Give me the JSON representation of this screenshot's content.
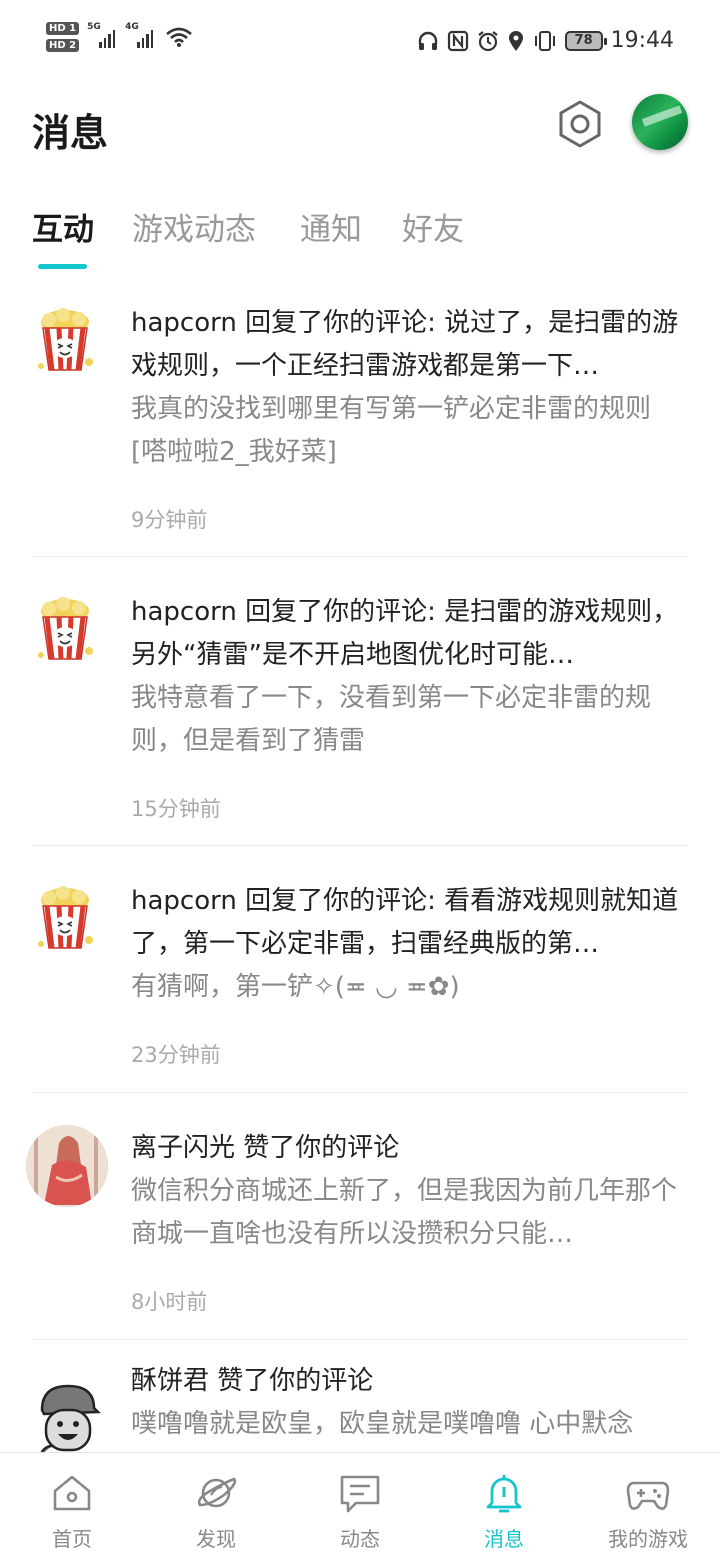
{
  "status_bar": {
    "hd1": "HD 1",
    "hd2": "HD 2",
    "net1": "5G",
    "net2": "4G",
    "battery": "78",
    "time": "19:44"
  },
  "header": {
    "title": "消息"
  },
  "tabs": [
    {
      "label": "互动",
      "active": true
    },
    {
      "label": "游戏动态",
      "active": false
    },
    {
      "label": "通知",
      "active": false
    },
    {
      "label": "好友",
      "active": false
    }
  ],
  "messages": [
    {
      "title": "hapcorn 回复了你的评论: 说过了，是扫雷的游戏规则，一个正经扫雷游戏都是第一下…",
      "content": "我真的没找到哪里有写第一铲必定非雷的规则[嗒啦啦2_我好菜]",
      "time": "9分钟前",
      "avatar": "popcorn-avatar"
    },
    {
      "title": "hapcorn 回复了你的评论: 是扫雷的游戏规则，另外“猜雷”是不开启地图优化时可能…",
      "content": "我特意看了一下，没看到第一下必定非雷的规则，但是看到了猜雷",
      "time": "15分钟前",
      "avatar": "popcorn-avatar"
    },
    {
      "title": "hapcorn 回复了你的评论: 看看游戏规则就知道了，第一下必定非雷，扫雷经典版的第…",
      "content": "有猜啊，第一铲✧(≖ ◡ ≖✿)",
      "time": "23分钟前",
      "avatar": "popcorn-avatar"
    },
    {
      "title": "离子闪光 赞了你的评论",
      "content": "微信积分商城还上新了，但是我因为前几年那个商城一直啥也没有所以没攒积分只能…",
      "time": "8小时前",
      "avatar": "anime-girl-avatar"
    },
    {
      "title": "酥饼君 赞了你的评论",
      "content": "噗噜噜就是欧皇，欧皇就是噗噜噜 心中默念",
      "time": "",
      "avatar": "cartoon-cap-avatar"
    }
  ],
  "bottom_nav": [
    {
      "label": "首页",
      "icon": "home-icon",
      "active": false
    },
    {
      "label": "发现",
      "icon": "planet-icon",
      "active": false
    },
    {
      "label": "动态",
      "icon": "chat-icon",
      "active": false
    },
    {
      "label": "消息",
      "icon": "bell-icon",
      "active": true
    },
    {
      "label": "我的游戏",
      "icon": "gamepad-icon",
      "active": false
    }
  ],
  "colors": {
    "accent": "#15c5ce",
    "text": "#222222",
    "muted": "#888888"
  }
}
